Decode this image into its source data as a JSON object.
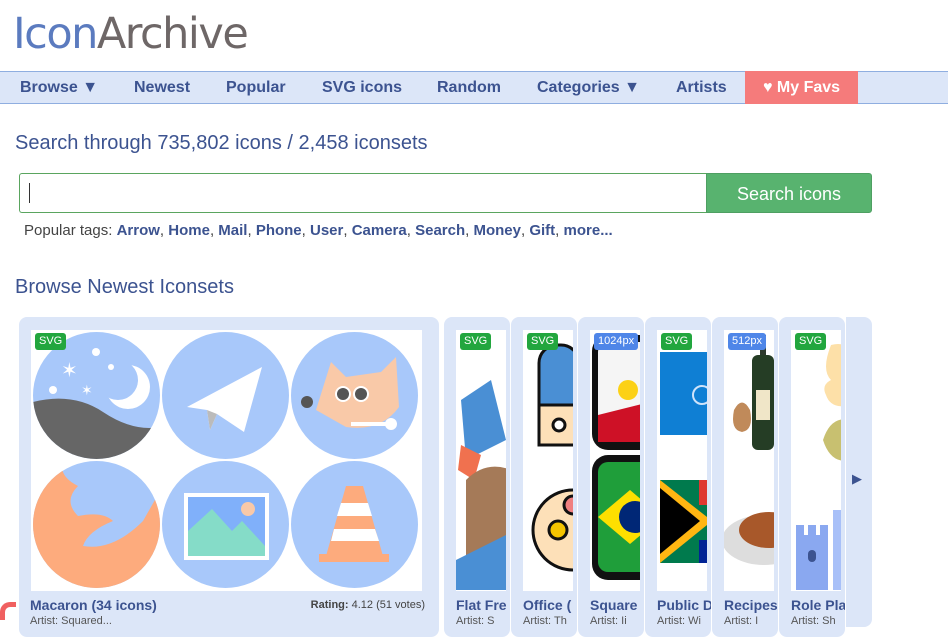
{
  "logo": {
    "part1": "Icon",
    "part2": "Archive"
  },
  "nav": {
    "items": [
      {
        "label": "Browse ▼"
      },
      {
        "label": "Newest"
      },
      {
        "label": "Popular"
      },
      {
        "label": "SVG icons"
      },
      {
        "label": "Random"
      },
      {
        "label": "Categories ▼"
      },
      {
        "label": "Artists"
      },
      {
        "label": "♥ My Favs"
      }
    ]
  },
  "search": {
    "headline": "Search through 735,802 icons / 2,458 iconsets",
    "value": "",
    "button_label": "Search icons",
    "tags_label": "Popular tags:",
    "tags": [
      "Arrow",
      "Home",
      "Mail",
      "Phone",
      "User",
      "Camera",
      "Search",
      "Money",
      "Gift",
      "more..."
    ]
  },
  "browse": {
    "title": "Browse Newest Iconsets",
    "featured": {
      "badge": "SVG",
      "title": "Macaron (34 icons)",
      "artist": "Artist: Squared...",
      "rating_label": "Rating:",
      "rating_value": "4.12 (51 votes)"
    },
    "cards": [
      {
        "badge": "SVG",
        "badge_type": "svg",
        "title": "Flat Fre",
        "artist": "Artist: S"
      },
      {
        "badge": "SVG",
        "badge_type": "svg",
        "title": "Office (",
        "artist": "Artist: Th"
      },
      {
        "badge": "1024px",
        "badge_type": "px",
        "title": "Square",
        "artist": "Artist: Ii"
      },
      {
        "badge": "SVG",
        "badge_type": "svg",
        "title": "Public D",
        "artist": "Artist: Wi"
      },
      {
        "badge": "512px",
        "badge_type": "px",
        "title": "Recipes",
        "artist": "Artist: I"
      },
      {
        "badge": "SVG",
        "badge_type": "svg",
        "title": "Role Pla",
        "artist": "Artist: Sh"
      }
    ],
    "next_icon": "▶"
  }
}
